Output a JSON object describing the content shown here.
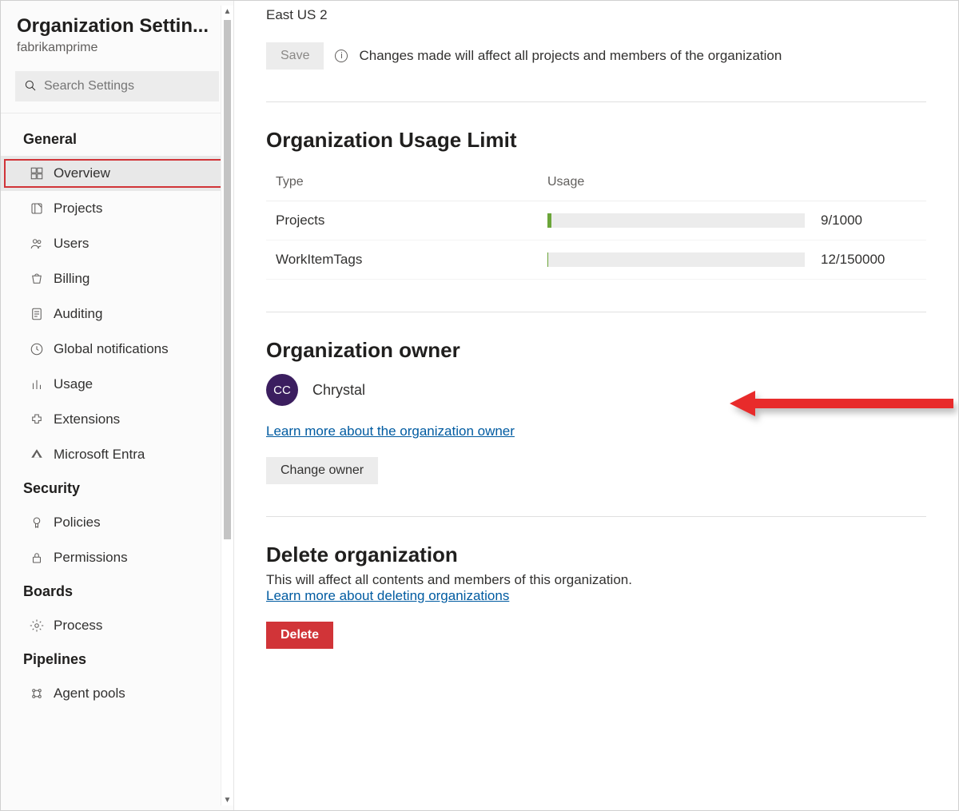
{
  "sidebar": {
    "title": "Organization Settin...",
    "subtitle": "fabrikamprime",
    "search_placeholder": "Search Settings",
    "groups": [
      {
        "title": "General",
        "items": [
          {
            "id": "overview",
            "label": "Overview",
            "active": true
          },
          {
            "id": "projects",
            "label": "Projects"
          },
          {
            "id": "users",
            "label": "Users"
          },
          {
            "id": "billing",
            "label": "Billing"
          },
          {
            "id": "auditing",
            "label": "Auditing"
          },
          {
            "id": "global-notifications",
            "label": "Global notifications"
          },
          {
            "id": "usage",
            "label": "Usage"
          },
          {
            "id": "extensions",
            "label": "Extensions"
          },
          {
            "id": "microsoft-entra",
            "label": "Microsoft Entra"
          }
        ]
      },
      {
        "title": "Security",
        "items": [
          {
            "id": "policies",
            "label": "Policies"
          },
          {
            "id": "permissions",
            "label": "Permissions"
          }
        ]
      },
      {
        "title": "Boards",
        "items": [
          {
            "id": "process",
            "label": "Process"
          }
        ]
      },
      {
        "title": "Pipelines",
        "items": [
          {
            "id": "agent-pools",
            "label": "Agent pools"
          }
        ]
      }
    ]
  },
  "main": {
    "region": "East US 2",
    "save_label": "Save",
    "changes_note": "Changes made will affect all projects and members of the organization",
    "usage": {
      "heading": "Organization Usage Limit",
      "col_type": "Type",
      "col_usage": "Usage",
      "rows": [
        {
          "type": "Projects",
          "used": 9,
          "limit": 1000,
          "display": "9/1000"
        },
        {
          "type": "WorkItemTags",
          "used": 12,
          "limit": 150000,
          "display": "12/150000"
        }
      ]
    },
    "owner": {
      "heading": "Organization owner",
      "avatar_initials": "CC",
      "name": "Chrystal",
      "learn_more": "Learn more about the organization owner",
      "change_label": "Change owner"
    },
    "delete": {
      "heading": "Delete organization",
      "description": "This will affect all contents and members of this organization.",
      "learn_more": "Learn more about deleting organizations",
      "button_label": "Delete"
    }
  }
}
